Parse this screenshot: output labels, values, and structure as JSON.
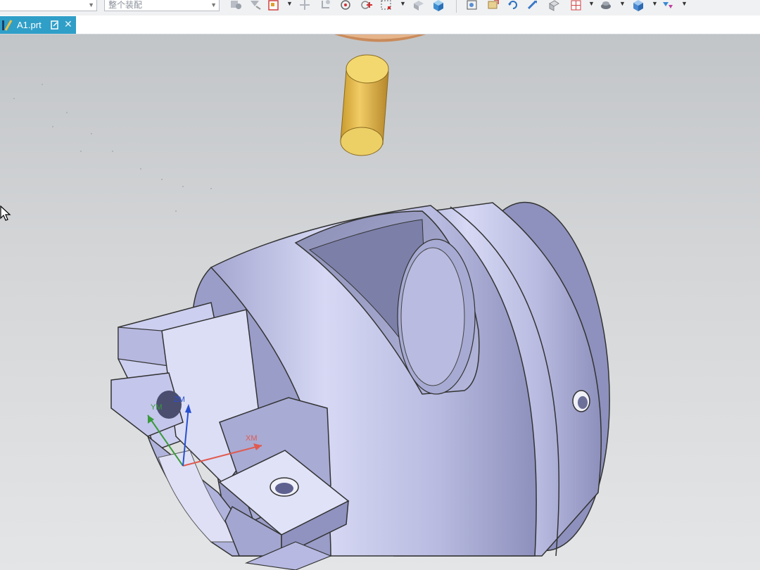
{
  "toolbar": {
    "filter_value": "",
    "selection_scope": "整个装配"
  },
  "tabs": [
    {
      "label": "A1.prt",
      "active": true
    }
  ],
  "axes": {
    "x_label": "XM",
    "y_label": "YM",
    "z_label": "ZM"
  },
  "icons": {
    "toolbar_left": [
      "snap-point-icon",
      "select-filter-icon",
      "face-select-icon",
      "point-icon",
      "move-icon",
      "circle-center-icon",
      "intersection-icon",
      "box-select-icon",
      "view-3d-icon",
      "cube-icon"
    ],
    "toolbar_right": [
      "fit-view-icon",
      "orient-icon",
      "rotate-icon",
      "pan-icon",
      "render-icon",
      "layout-icon",
      "shade-icon",
      "view-cube-icon",
      "filter-view-icon"
    ]
  },
  "colors": {
    "tab_active": "#2f9fc8",
    "part_face": "#c6c8ea",
    "tool_holder": "#e2b44c",
    "x_axis": "#e05a50",
    "y_axis": "#3a9a3a",
    "z_axis": "#2850d0"
  }
}
